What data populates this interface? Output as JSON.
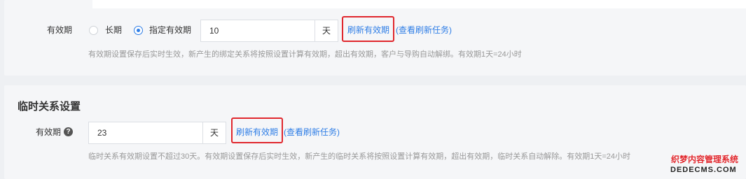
{
  "validity_section": {
    "label": "有效期",
    "option_long": "长期",
    "option_custom": "指定有效期",
    "selected": "指定有效期",
    "days_value": "10",
    "unit": "天",
    "refresh_link": "刷新有效期",
    "view_tasks_link": "(查看刷新任务)",
    "hint": "有效期设置保存后实时生效，新产生的绑定关系将按照设置计算有效期，超出有效期，客户与导购自动解绑。有效期1天=24小时"
  },
  "temp_section": {
    "title": "临时关系设置",
    "label": "有效期",
    "help_icon": "?",
    "days_value": "23",
    "unit": "天",
    "refresh_link": "刷新有效期",
    "view_tasks_link": "(查看刷新任务)",
    "hint": "临时关系有效期设置不超过30天。有效期设置保存后实时生效，新产生的临时关系将按照设置计算有效期，超出有效期，临时关系自动解除。有效期1天=24小时"
  },
  "highlight_color": "#e0272d",
  "link_color": "#2f7ee6",
  "watermark": {
    "cn": "织梦内容管理系统",
    "en": "DEDECMS.COM"
  }
}
